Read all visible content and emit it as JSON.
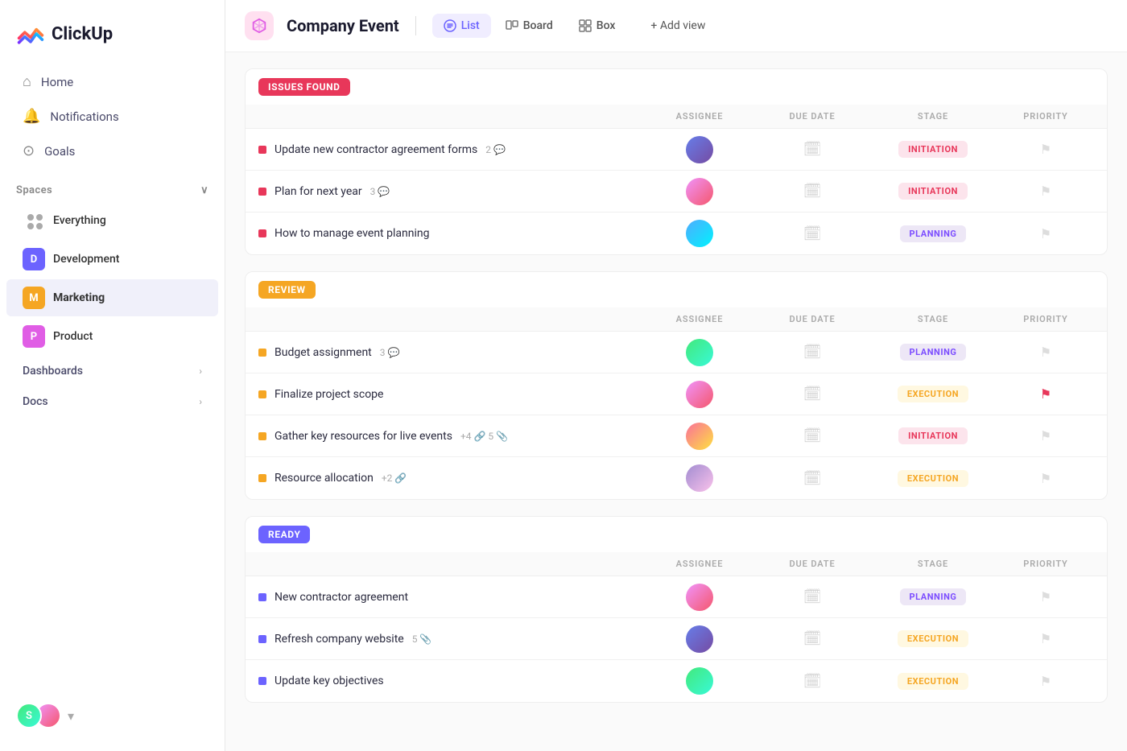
{
  "app": {
    "name": "ClickUp"
  },
  "sidebar": {
    "nav": [
      {
        "id": "home",
        "label": "Home",
        "icon": "🏠"
      },
      {
        "id": "notifications",
        "label": "Notifications",
        "icon": "🔔"
      },
      {
        "id": "goals",
        "label": "Goals",
        "icon": "🎯"
      }
    ],
    "spaces_label": "Spaces",
    "spaces": [
      {
        "id": "everything",
        "label": "Everything",
        "type": "grid"
      },
      {
        "id": "development",
        "label": "Development",
        "type": "letter",
        "letter": "D",
        "color": "#6c63ff"
      },
      {
        "id": "marketing",
        "label": "Marketing",
        "type": "letter",
        "letter": "M",
        "color": "#f5a623",
        "bold": true
      },
      {
        "id": "product",
        "label": "Product",
        "type": "letter",
        "letter": "P",
        "color": "#e05de5"
      }
    ],
    "sections": [
      {
        "id": "dashboards",
        "label": "Dashboards"
      },
      {
        "id": "docs",
        "label": "Docs"
      }
    ]
  },
  "header": {
    "project_name": "Company Event",
    "project_icon": "📦",
    "views": [
      {
        "id": "list",
        "label": "List",
        "icon": "≡",
        "active": true
      },
      {
        "id": "board",
        "label": "Board",
        "icon": "⊞",
        "active": false
      },
      {
        "id": "box",
        "label": "Box",
        "icon": "▦",
        "active": false
      }
    ],
    "add_view_label": "+ Add view"
  },
  "groups": [
    {
      "id": "issues-found",
      "badge_label": "ISSUES FOUND",
      "badge_class": "badge-issues",
      "columns": [
        "ASSIGNEE",
        "DUE DATE",
        "STAGE",
        "PRIORITY"
      ],
      "tasks": [
        {
          "name": "Update new contractor agreement forms",
          "meta_count": "2",
          "meta_icon": "💬",
          "bullet_class": "bullet-red",
          "avatar_class": "av-1",
          "stage": "INITIATION",
          "stage_class": "stage-initiation",
          "flag_red": false
        },
        {
          "name": "Plan for next year",
          "meta_count": "3",
          "meta_icon": "💬",
          "bullet_class": "bullet-red",
          "avatar_class": "av-2",
          "stage": "INITIATION",
          "stage_class": "stage-initiation",
          "flag_red": false
        },
        {
          "name": "How to manage event planning",
          "meta_count": "",
          "meta_icon": "",
          "bullet_class": "bullet-red",
          "avatar_class": "av-3",
          "stage": "PLANNING",
          "stage_class": "stage-planning",
          "flag_red": false
        }
      ]
    },
    {
      "id": "review",
      "badge_label": "REVIEW",
      "badge_class": "badge-review",
      "columns": [
        "ASSIGNEE",
        "DUE DATE",
        "STAGE",
        "PRIORITY"
      ],
      "tasks": [
        {
          "name": "Budget assignment",
          "meta_count": "3",
          "meta_icon": "💬",
          "bullet_class": "bullet-yellow",
          "avatar_class": "av-4",
          "stage": "PLANNING",
          "stage_class": "stage-planning",
          "flag_red": false
        },
        {
          "name": "Finalize project scope",
          "meta_count": "",
          "meta_icon": "",
          "bullet_class": "bullet-yellow",
          "avatar_class": "av-2",
          "stage": "EXECUTION",
          "stage_class": "stage-execution",
          "flag_red": true
        },
        {
          "name": "Gather key resources for live events",
          "meta_count": "+4",
          "meta_extra": "5 📎",
          "meta_icon": "🔗",
          "bullet_class": "bullet-yellow",
          "avatar_class": "av-5",
          "stage": "INITIATION",
          "stage_class": "stage-initiation",
          "flag_red": false
        },
        {
          "name": "Resource allocation",
          "meta_count": "+2",
          "meta_icon": "🔗",
          "bullet_class": "bullet-yellow",
          "avatar_class": "av-6",
          "stage": "EXECUTION",
          "stage_class": "stage-execution",
          "flag_red": false
        }
      ]
    },
    {
      "id": "ready",
      "badge_label": "READY",
      "badge_class": "badge-ready",
      "columns": [
        "ASSIGNEE",
        "DUE DATE",
        "STAGE",
        "PRIORITY"
      ],
      "tasks": [
        {
          "name": "New contractor agreement",
          "meta_count": "",
          "meta_icon": "",
          "bullet_class": "bullet-purple",
          "avatar_class": "av-2",
          "stage": "PLANNING",
          "stage_class": "stage-planning",
          "flag_red": false
        },
        {
          "name": "Refresh company website",
          "meta_count": "5 📎",
          "meta_icon": "",
          "bullet_class": "bullet-purple",
          "avatar_class": "av-1",
          "stage": "EXECUTION",
          "stage_class": "stage-execution",
          "flag_red": false
        },
        {
          "name": "Update key objectives",
          "meta_count": "",
          "meta_icon": "",
          "bullet_class": "bullet-purple",
          "avatar_class": "av-4",
          "stage": "EXECUTION",
          "stage_class": "stage-execution",
          "flag_red": false
        }
      ]
    }
  ]
}
